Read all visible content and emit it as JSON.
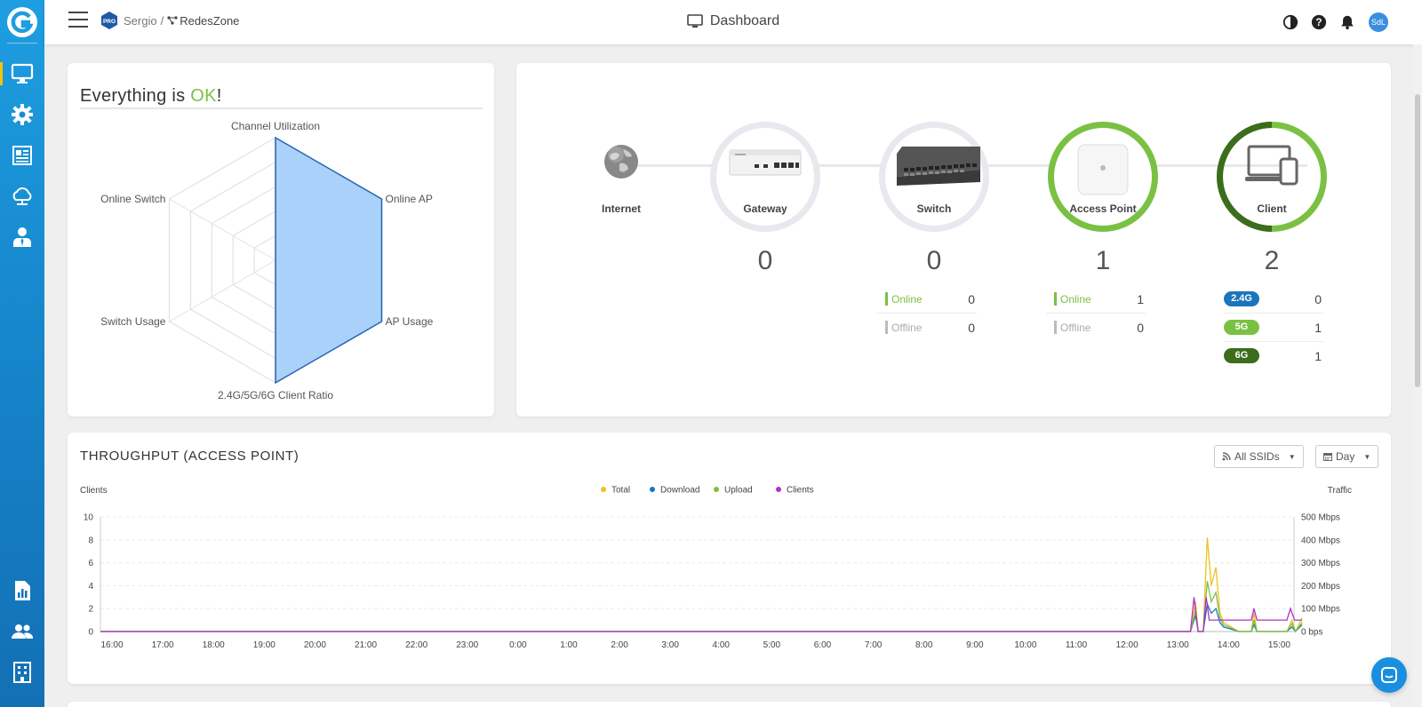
{
  "header": {
    "org": "Sergio",
    "separator": "/",
    "network": "RedesZone",
    "pro_badge": "PRO",
    "title": "Dashboard",
    "avatar_initials": "SdL"
  },
  "health": {
    "title_prefix": "Everything is ",
    "title_status": "OK",
    "title_suffix": "!",
    "status_color": "#7ac143",
    "radar_axes": [
      "Channel Utilization",
      "Online AP",
      "AP Usage",
      "2.4G/5G/6G Client Ratio",
      "Switch Usage",
      "Online Switch"
    ],
    "radar_values": [
      1,
      1,
      1,
      1,
      0,
      0
    ],
    "radar_fill_color": "#a4cff9"
  },
  "topology": {
    "nodes": [
      {
        "label": "Internet"
      },
      {
        "label": "Gateway",
        "count": "0"
      },
      {
        "label": "Switch",
        "count": "0",
        "stats": [
          {
            "name": "Online",
            "value": "0"
          },
          {
            "name": "Offline",
            "value": "0"
          }
        ]
      },
      {
        "label": "Access Point",
        "count": "1",
        "stats": [
          {
            "name": "Online",
            "value": "1"
          },
          {
            "name": "Offline",
            "value": "0"
          }
        ]
      },
      {
        "label": "Client",
        "count": "2",
        "bands": [
          {
            "name": "2.4G",
            "value": "0",
            "color": "#1b75bb"
          },
          {
            "name": "5G",
            "value": "1",
            "color": "#7ac143"
          },
          {
            "name": "6G",
            "value": "1",
            "color": "#3b6d1d"
          }
        ]
      }
    ],
    "online_color": "#7ac143",
    "offline_color": "#bbbbbb"
  },
  "throughput": {
    "title": "THROUGHPUT (ACCESS POINT)",
    "ssid_filter": "All SSIDs",
    "period_filter": "Day",
    "chart_data": {
      "type": "line",
      "left_axis_label": "Clients",
      "right_axis_label": "Traffic",
      "left_ticks": [
        "0",
        "2",
        "4",
        "6",
        "8",
        "10"
      ],
      "right_ticks": [
        "0 bps",
        "100 Mbps",
        "200 Mbps",
        "300 Mbps",
        "400 Mbps",
        "500 Mbps"
      ],
      "ylim_clients": [
        0,
        10
      ],
      "ylim_traffic_mbps": [
        0,
        500
      ],
      "x_ticks": [
        "16:00",
        "17:00",
        "18:00",
        "19:00",
        "20:00",
        "21:00",
        "22:00",
        "23:00",
        "0:00",
        "1:00",
        "2:00",
        "3:00",
        "4:00",
        "5:00",
        "6:00",
        "7:00",
        "8:00",
        "9:00",
        "10:00",
        "11:00",
        "12:00",
        "13:00",
        "14:00",
        "15:00"
      ],
      "x_range_hours": [
        15.8,
        15.8
      ],
      "legend": [
        {
          "name": "Total",
          "color": "#f0c020"
        },
        {
          "name": "Download",
          "color": "#1b75bb"
        },
        {
          "name": "Upload",
          "color": "#7ac143"
        },
        {
          "name": "Clients",
          "color": "#b030c8"
        }
      ],
      "series": [
        {
          "name": "Total",
          "axis": "traffic",
          "points": [
            [
              13.0,
              0
            ],
            [
              13.25,
              0
            ],
            [
              13.35,
              130
            ],
            [
              13.4,
              0
            ],
            [
              13.5,
              0
            ],
            [
              13.58,
              410
            ],
            [
              13.66,
              200
            ],
            [
              13.75,
              280
            ],
            [
              13.83,
              80
            ],
            [
              13.9,
              40
            ],
            [
              14.2,
              0
            ],
            [
              14.45,
              0
            ],
            [
              14.5,
              80
            ],
            [
              14.56,
              0
            ],
            [
              15.15,
              0
            ],
            [
              15.25,
              50
            ],
            [
              15.32,
              0
            ],
            [
              15.45,
              60
            ]
          ]
        },
        {
          "name": "Download",
          "axis": "traffic",
          "points": [
            [
              13.0,
              0
            ],
            [
              13.25,
              0
            ],
            [
              13.35,
              70
            ],
            [
              13.4,
              0
            ],
            [
              13.5,
              0
            ],
            [
              13.58,
              120
            ],
            [
              13.66,
              80
            ],
            [
              13.75,
              100
            ],
            [
              13.83,
              40
            ],
            [
              13.9,
              20
            ],
            [
              14.2,
              0
            ],
            [
              14.45,
              0
            ],
            [
              14.5,
              30
            ],
            [
              14.56,
              0
            ],
            [
              15.15,
              0
            ],
            [
              15.25,
              20
            ],
            [
              15.32,
              0
            ],
            [
              15.45,
              30
            ]
          ]
        },
        {
          "name": "Upload",
          "axis": "traffic",
          "points": [
            [
              13.0,
              0
            ],
            [
              13.25,
              0
            ],
            [
              13.35,
              90
            ],
            [
              13.4,
              0
            ],
            [
              13.5,
              0
            ],
            [
              13.58,
              220
            ],
            [
              13.66,
              130
            ],
            [
              13.75,
              170
            ],
            [
              13.83,
              60
            ],
            [
              13.9,
              30
            ],
            [
              14.2,
              0
            ],
            [
              14.45,
              0
            ],
            [
              14.5,
              50
            ],
            [
              14.56,
              0
            ],
            [
              15.15,
              0
            ],
            [
              15.25,
              35
            ],
            [
              15.32,
              0
            ],
            [
              15.45,
              40
            ]
          ]
        },
        {
          "name": "Clients",
          "axis": "clients",
          "points": [
            [
              13.0,
              0
            ],
            [
              13.25,
              0
            ],
            [
              13.32,
              3
            ],
            [
              13.4,
              0
            ],
            [
              13.5,
              0
            ],
            [
              13.56,
              3
            ],
            [
              13.62,
              1
            ],
            [
              14.45,
              1
            ],
            [
              14.5,
              2
            ],
            [
              14.56,
              1
            ],
            [
              15.15,
              1
            ],
            [
              15.22,
              2
            ],
            [
              15.3,
              1
            ],
            [
              15.45,
              1
            ]
          ]
        }
      ]
    }
  }
}
